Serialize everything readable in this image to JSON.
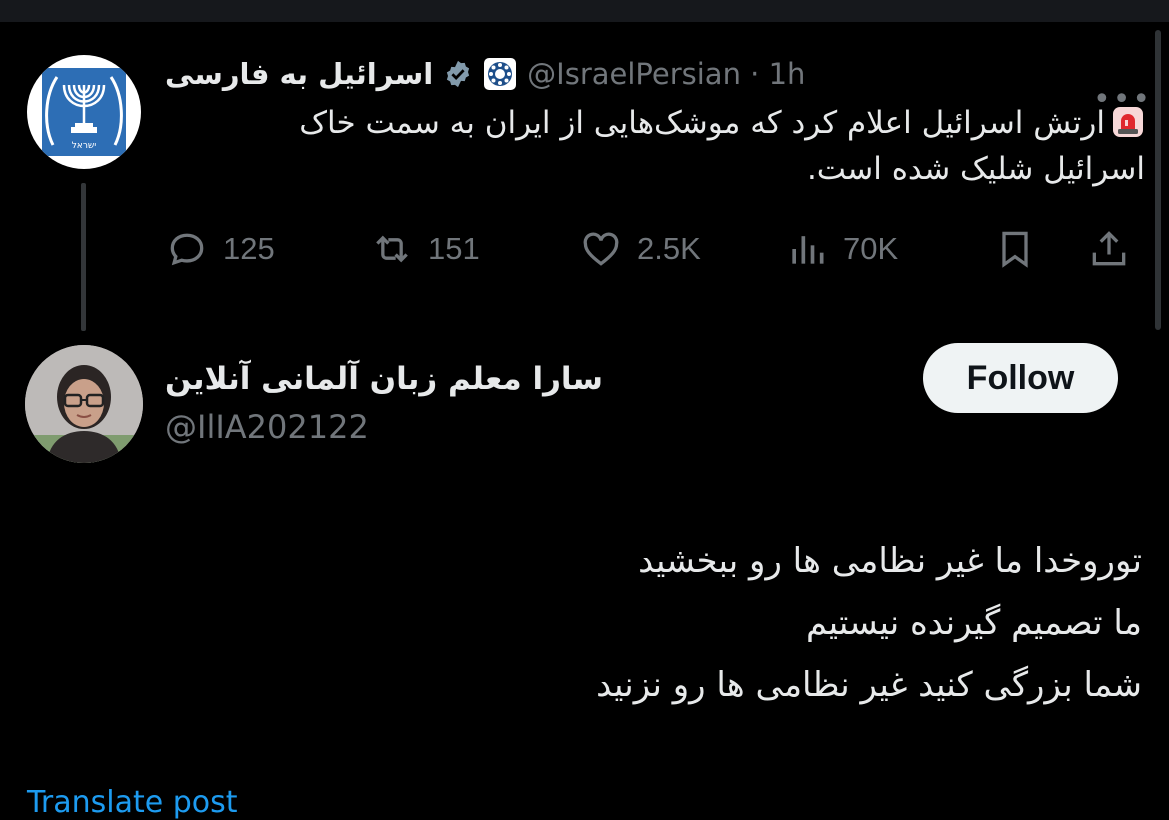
{
  "tweet": {
    "author_name": "اسرائیل به فارسی",
    "handle": "@IsraelPersian",
    "separator": "·",
    "time": "1h",
    "text_lines": [
      "ارتش اسرائیل اعلام کرد که موشک‌هایی از ایران به سمت خاک",
      "اسرائیل شلیک شده است."
    ],
    "stats": {
      "replies": "125",
      "retweets": "151",
      "likes": "2.5K",
      "views": "70K"
    },
    "avatar_logo_text": "ישראל"
  },
  "reply": {
    "author_name": "سارا معلم زبان آلمانی آنلاین",
    "handle": "@IlIA202122",
    "follow_label": "Follow",
    "text_lines": [
      "توروخدا ما غیر نظامی ها رو ببخشید",
      "ما تصمیم گیرنده نیستیم",
      "شما بزرگی کنید غیر نظامی ها رو نزنید"
    ],
    "translate_label": "Translate post"
  },
  "icons": {
    "verified": "verified-badge-icon",
    "org": "affiliate-badge-icon",
    "siren": "police-light-emoji",
    "reply": "reply-icon",
    "retweet": "retweet-icon",
    "like": "heart-icon",
    "views": "views-icon",
    "bookmark": "bookmark-icon",
    "share": "share-icon",
    "more": "more-icon"
  },
  "colors": {
    "background": "#000000",
    "text": "#e7e9ea",
    "secondary": "#71767b",
    "link": "#1d9bf0",
    "verified": "#829aab",
    "follow_bg": "#eff3f4"
  }
}
